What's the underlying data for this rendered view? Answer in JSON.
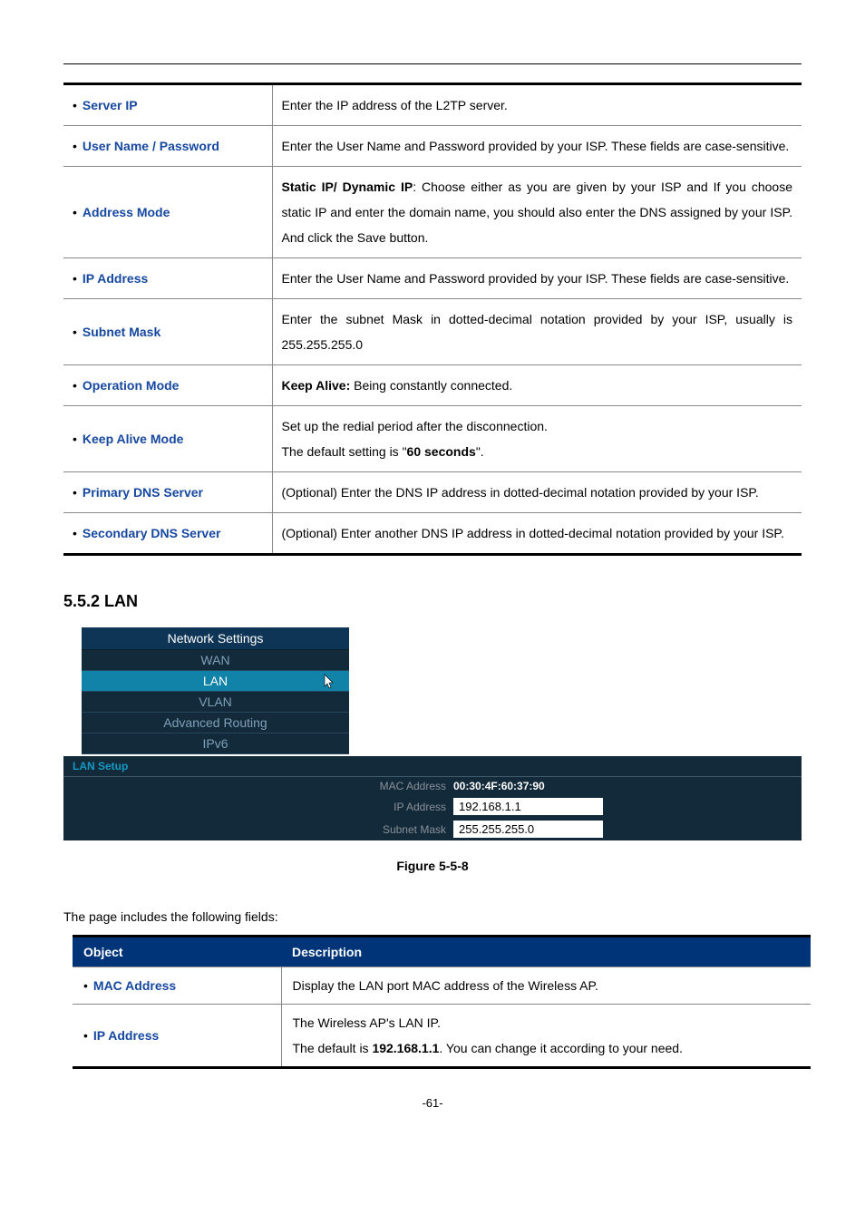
{
  "table1": {
    "rows": [
      {
        "label": "Server IP",
        "desc": "Enter the IP address of the L2TP server."
      },
      {
        "label": "User Name / Password",
        "desc": "Enter the User Name and Password provided by your ISP. These fields are case-sensitive."
      },
      {
        "label": "Address Mode",
        "desc_prefix_bold": "Static IP/ Dynamic IP",
        "desc_rest": ": Choose either as you are given by your ISP and If you choose static IP and enter the domain name, you should also enter the DNS assigned by your ISP. And click the Save button."
      },
      {
        "label": "IP Address",
        "desc": "Enter the User Name and Password provided by your ISP. These fields are case-sensitive."
      },
      {
        "label": "Subnet Mask",
        "desc": "Enter the subnet Mask in dotted-decimal notation provided by your ISP, usually is 255.255.255.0"
      },
      {
        "label": "Operation Mode",
        "desc_prefix_bold": "Keep Alive:",
        "desc_rest": " Being constantly connected."
      },
      {
        "label": "Keep Alive Mode",
        "desc_line1": "Set up the redial period after the disconnection.",
        "desc_line2_pre": "The default setting is \"",
        "desc_line2_bold": "60 seconds",
        "desc_line2_post": "\"."
      },
      {
        "label": "Primary DNS Server",
        "desc": "(Optional) Enter the DNS IP address in dotted-decimal notation provided by your ISP."
      },
      {
        "label": "Secondary DNS Server",
        "desc": "(Optional) Enter another DNS IP address in dotted-decimal notation provided by your ISP."
      }
    ]
  },
  "section_heading": "5.5.2  LAN",
  "nav": {
    "header": "Network Settings",
    "items": [
      "WAN",
      "LAN",
      "VLAN",
      "Advanced Routing",
      "IPv6"
    ],
    "active_index": 1
  },
  "lan_setup": {
    "title": "LAN Setup",
    "mac_label": "MAC Address",
    "mac_value": "00:30:4F:60:37:90",
    "ip_label": "IP Address",
    "ip_value": "192.168.1.1",
    "subnet_label": "Subnet Mask",
    "subnet_value": "255.255.255.0"
  },
  "figure_caption": "Figure 5-5-8",
  "intro_text": "The page includes the following fields:",
  "table2": {
    "head_object": "Object",
    "head_desc": "Description",
    "rows": [
      {
        "label": "MAC Address",
        "desc": "Display the LAN port MAC address of the Wireless AP."
      },
      {
        "label": "IP Address",
        "desc_line1": "The Wireless AP's LAN IP.",
        "desc_line2_pre": "The default is ",
        "desc_line2_bold": "192.168.1.1",
        "desc_line2_post": ". You can change it according to your need."
      }
    ]
  },
  "page_number": "-61-"
}
